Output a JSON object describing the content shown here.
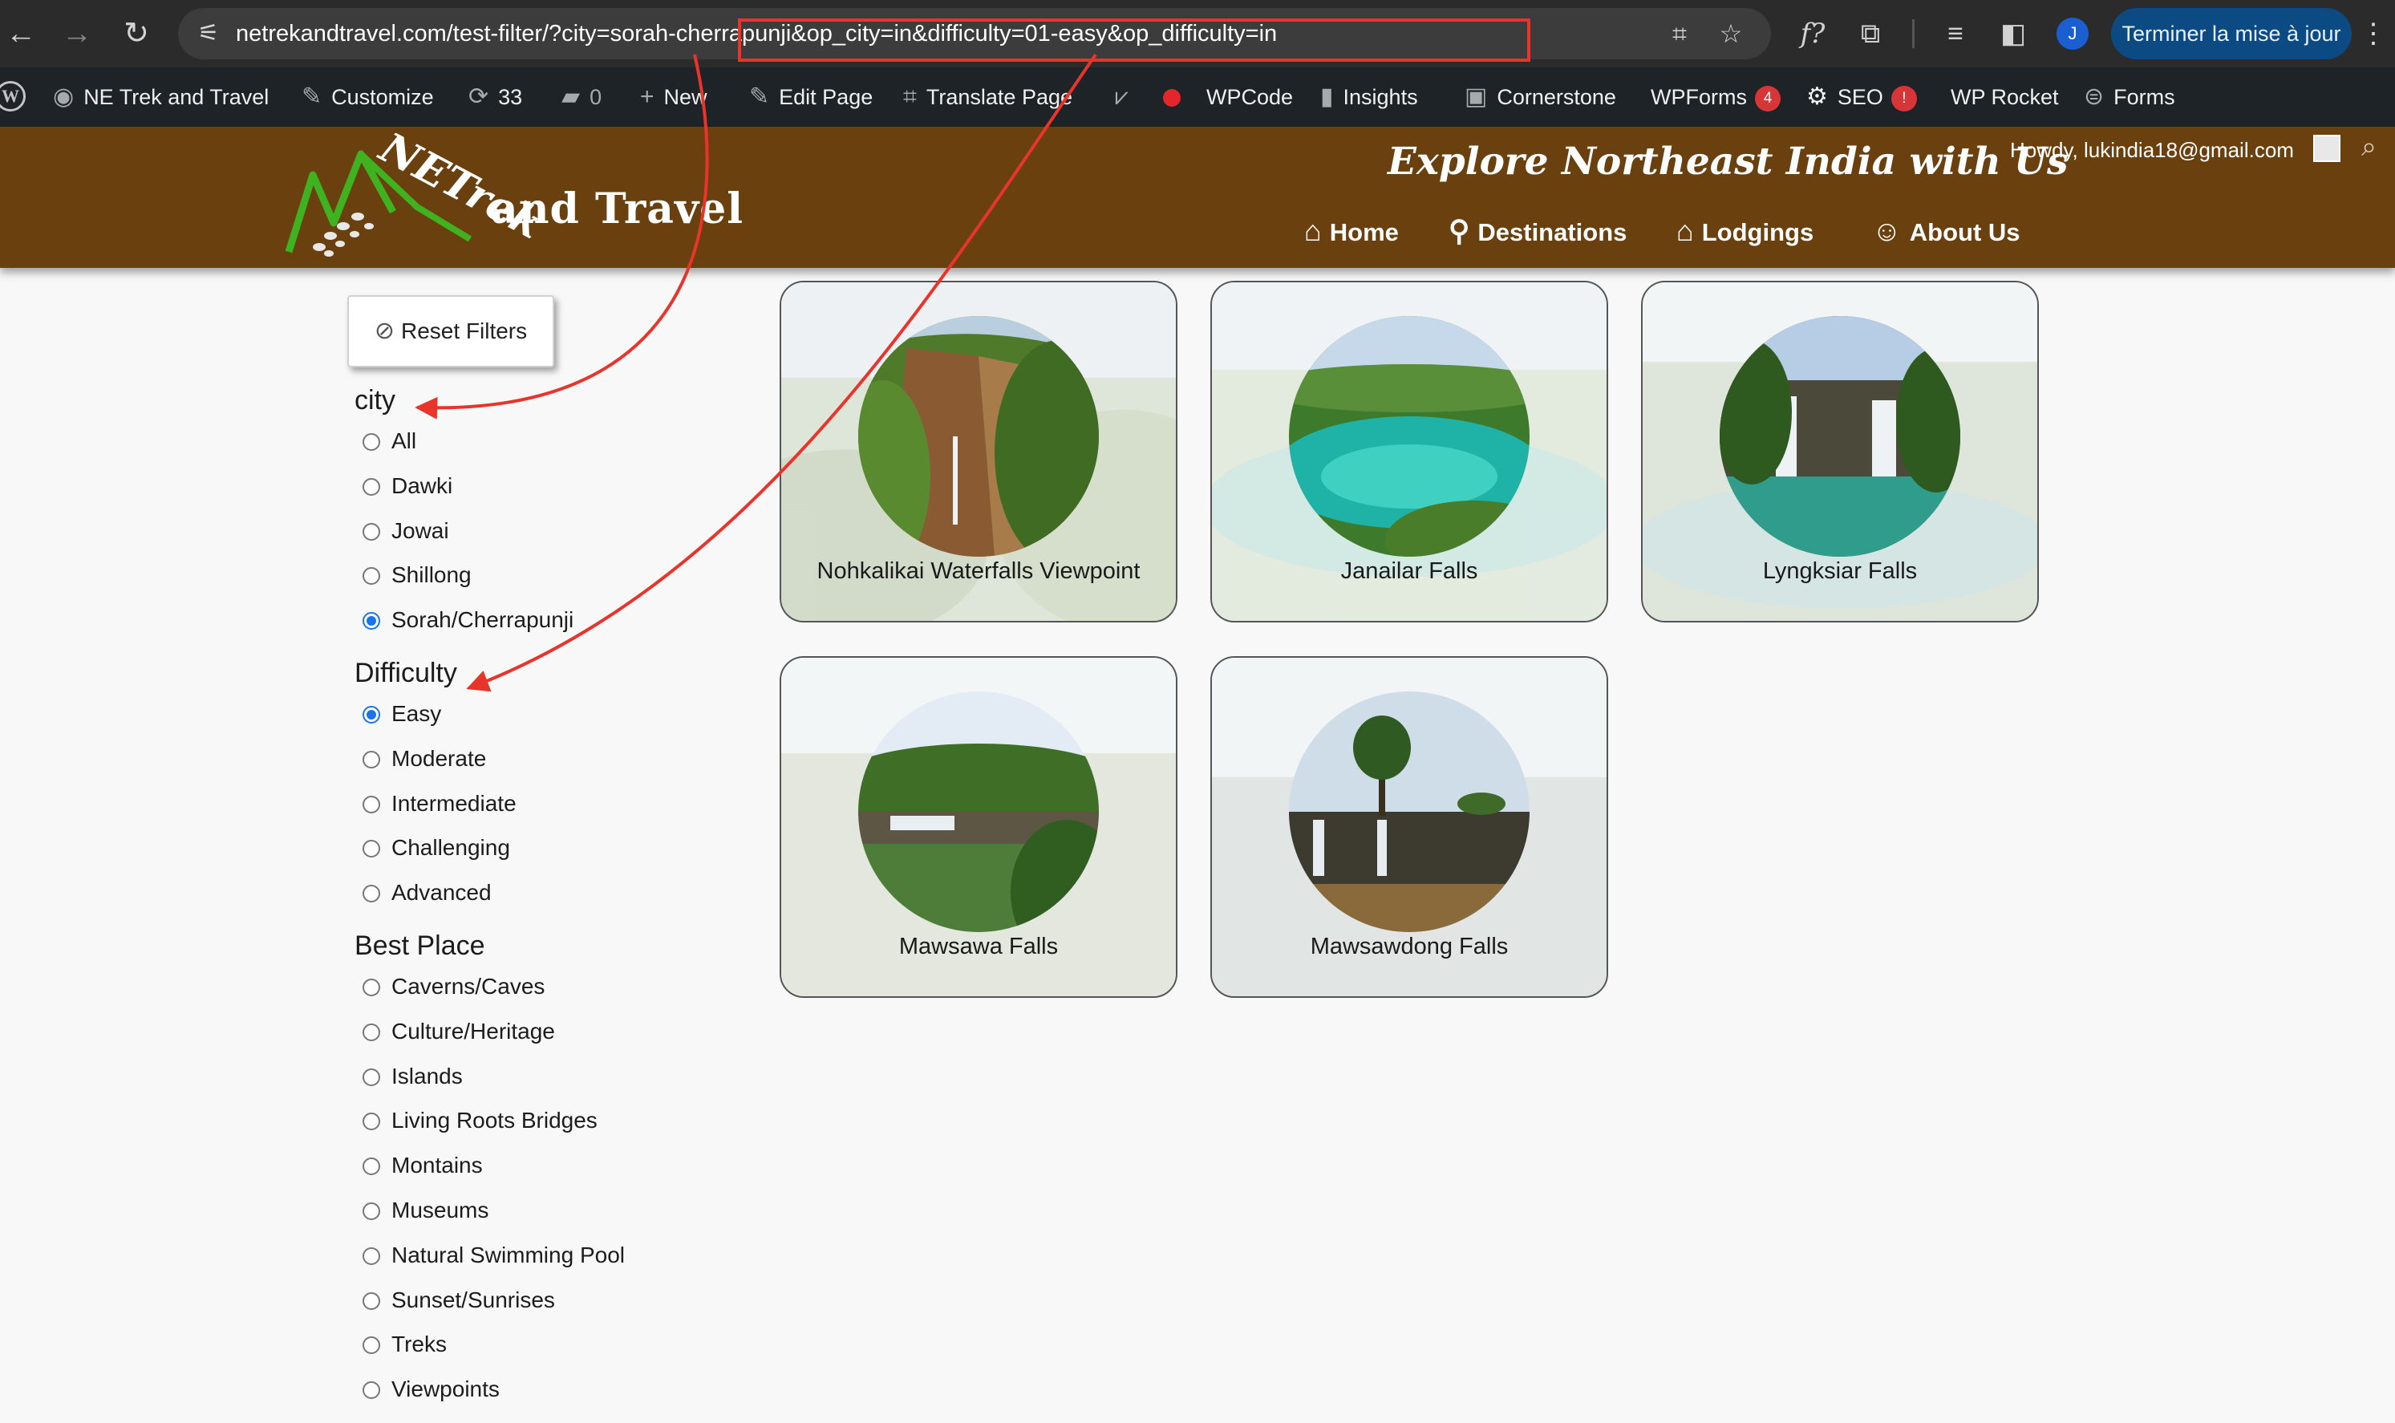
{
  "browser": {
    "url_host": "netrekandtravel.com/test-filter",
    "url_query": "/?city=sorah-cherrapunji&op_city=in&difficulty=01-easy&op_difficulty=in",
    "avatar_letter": "J",
    "update_label": "Terminer la mise à jour"
  },
  "admin_bar": {
    "site_name": "NE Trek and Travel",
    "customize": "Customize",
    "updates_count": "33",
    "comments_count": "0",
    "new": "New",
    "edit_page": "Edit Page",
    "translate_page": "Translate Page",
    "wpcode": "WPCode",
    "insights": "Insights",
    "cornerstone": "Cornerstone",
    "wpforms": "WPForms",
    "wpforms_badge": "4",
    "seo": "SEO",
    "seo_badge": "!",
    "wp_rocket": "WP Rocket",
    "forms": "Forms"
  },
  "header": {
    "logo_ne": "NETrek",
    "logo_and_travel": "and Travel",
    "tagline": "Explore Northeast India with Us",
    "howdy": "Howdy, lukindia18@gmail.com",
    "nav": [
      "Home",
      "Destinations",
      "Lodgings",
      "About Us"
    ]
  },
  "filters": {
    "reset_label": "Reset Filters",
    "groups": [
      {
        "title": "city",
        "options": [
          "All",
          "Dawki",
          "Jowai",
          "Shillong",
          "Sorah/Cherrapunji"
        ],
        "selected": "Sorah/Cherrapunji"
      },
      {
        "title": "Difficulty",
        "options": [
          "Easy",
          "Moderate",
          "Intermediate",
          "Challenging",
          "Advanced"
        ],
        "selected": "Easy"
      },
      {
        "title": "Best Place",
        "options": [
          "Caverns/Caves",
          "Culture/Heritage",
          "Islands",
          "Living Roots Bridges",
          "Montains",
          "Museums",
          "Natural Swimming Pool",
          "Sunset/Sunrises",
          "Treks",
          "Viewpoints"
        ],
        "selected": ""
      }
    ]
  },
  "results": [
    {
      "title": "Nohkalikai Waterfalls Viewpoint"
    },
    {
      "title": "Janailar Falls"
    },
    {
      "title": "Lyngksiar Falls"
    },
    {
      "title": "Mawsawa Falls"
    },
    {
      "title": "Mawsawdong Falls"
    }
  ],
  "colors": {
    "header_brown": "#6b400f",
    "annotation_red": "#e8352b",
    "radio_blue": "#1a73e8"
  }
}
